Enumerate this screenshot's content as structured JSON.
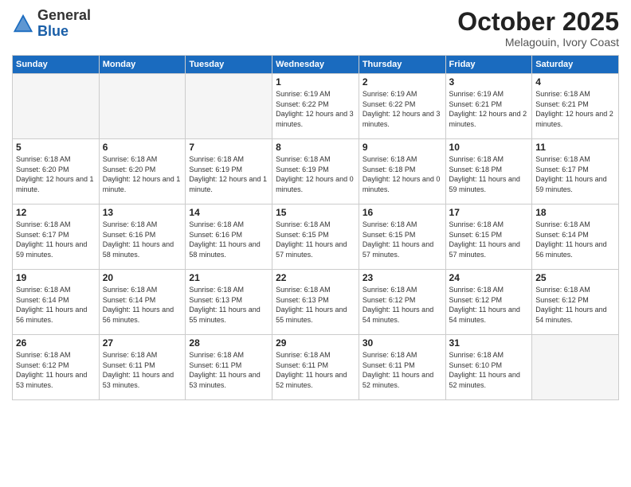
{
  "header": {
    "logo_line1": "General",
    "logo_line2": "Blue",
    "title": "October 2025",
    "subtitle": "Melagouin, Ivory Coast"
  },
  "days_of_week": [
    "Sunday",
    "Monday",
    "Tuesday",
    "Wednesday",
    "Thursday",
    "Friday",
    "Saturday"
  ],
  "weeks": [
    [
      {
        "day": "",
        "info": ""
      },
      {
        "day": "",
        "info": ""
      },
      {
        "day": "",
        "info": ""
      },
      {
        "day": "1",
        "info": "Sunrise: 6:19 AM\nSunset: 6:22 PM\nDaylight: 12 hours\nand 3 minutes."
      },
      {
        "day": "2",
        "info": "Sunrise: 6:19 AM\nSunset: 6:22 PM\nDaylight: 12 hours\nand 3 minutes."
      },
      {
        "day": "3",
        "info": "Sunrise: 6:19 AM\nSunset: 6:21 PM\nDaylight: 12 hours\nand 2 minutes."
      },
      {
        "day": "4",
        "info": "Sunrise: 6:18 AM\nSunset: 6:21 PM\nDaylight: 12 hours\nand 2 minutes."
      }
    ],
    [
      {
        "day": "5",
        "info": "Sunrise: 6:18 AM\nSunset: 6:20 PM\nDaylight: 12 hours\nand 1 minute."
      },
      {
        "day": "6",
        "info": "Sunrise: 6:18 AM\nSunset: 6:20 PM\nDaylight: 12 hours\nand 1 minute."
      },
      {
        "day": "7",
        "info": "Sunrise: 6:18 AM\nSunset: 6:19 PM\nDaylight: 12 hours\nand 1 minute."
      },
      {
        "day": "8",
        "info": "Sunrise: 6:18 AM\nSunset: 6:19 PM\nDaylight: 12 hours\nand 0 minutes."
      },
      {
        "day": "9",
        "info": "Sunrise: 6:18 AM\nSunset: 6:18 PM\nDaylight: 12 hours\nand 0 minutes."
      },
      {
        "day": "10",
        "info": "Sunrise: 6:18 AM\nSunset: 6:18 PM\nDaylight: 11 hours\nand 59 minutes."
      },
      {
        "day": "11",
        "info": "Sunrise: 6:18 AM\nSunset: 6:17 PM\nDaylight: 11 hours\nand 59 minutes."
      }
    ],
    [
      {
        "day": "12",
        "info": "Sunrise: 6:18 AM\nSunset: 6:17 PM\nDaylight: 11 hours\nand 59 minutes."
      },
      {
        "day": "13",
        "info": "Sunrise: 6:18 AM\nSunset: 6:16 PM\nDaylight: 11 hours\nand 58 minutes."
      },
      {
        "day": "14",
        "info": "Sunrise: 6:18 AM\nSunset: 6:16 PM\nDaylight: 11 hours\nand 58 minutes."
      },
      {
        "day": "15",
        "info": "Sunrise: 6:18 AM\nSunset: 6:15 PM\nDaylight: 11 hours\nand 57 minutes."
      },
      {
        "day": "16",
        "info": "Sunrise: 6:18 AM\nSunset: 6:15 PM\nDaylight: 11 hours\nand 57 minutes."
      },
      {
        "day": "17",
        "info": "Sunrise: 6:18 AM\nSunset: 6:15 PM\nDaylight: 11 hours\nand 57 minutes."
      },
      {
        "day": "18",
        "info": "Sunrise: 6:18 AM\nSunset: 6:14 PM\nDaylight: 11 hours\nand 56 minutes."
      }
    ],
    [
      {
        "day": "19",
        "info": "Sunrise: 6:18 AM\nSunset: 6:14 PM\nDaylight: 11 hours\nand 56 minutes."
      },
      {
        "day": "20",
        "info": "Sunrise: 6:18 AM\nSunset: 6:14 PM\nDaylight: 11 hours\nand 56 minutes."
      },
      {
        "day": "21",
        "info": "Sunrise: 6:18 AM\nSunset: 6:13 PM\nDaylight: 11 hours\nand 55 minutes."
      },
      {
        "day": "22",
        "info": "Sunrise: 6:18 AM\nSunset: 6:13 PM\nDaylight: 11 hours\nand 55 minutes."
      },
      {
        "day": "23",
        "info": "Sunrise: 6:18 AM\nSunset: 6:12 PM\nDaylight: 11 hours\nand 54 minutes."
      },
      {
        "day": "24",
        "info": "Sunrise: 6:18 AM\nSunset: 6:12 PM\nDaylight: 11 hours\nand 54 minutes."
      },
      {
        "day": "25",
        "info": "Sunrise: 6:18 AM\nSunset: 6:12 PM\nDaylight: 11 hours\nand 54 minutes."
      }
    ],
    [
      {
        "day": "26",
        "info": "Sunrise: 6:18 AM\nSunset: 6:12 PM\nDaylight: 11 hours\nand 53 minutes."
      },
      {
        "day": "27",
        "info": "Sunrise: 6:18 AM\nSunset: 6:11 PM\nDaylight: 11 hours\nand 53 minutes."
      },
      {
        "day": "28",
        "info": "Sunrise: 6:18 AM\nSunset: 6:11 PM\nDaylight: 11 hours\nand 53 minutes."
      },
      {
        "day": "29",
        "info": "Sunrise: 6:18 AM\nSunset: 6:11 PM\nDaylight: 11 hours\nand 52 minutes."
      },
      {
        "day": "30",
        "info": "Sunrise: 6:18 AM\nSunset: 6:11 PM\nDaylight: 11 hours\nand 52 minutes."
      },
      {
        "day": "31",
        "info": "Sunrise: 6:18 AM\nSunset: 6:10 PM\nDaylight: 11 hours\nand 52 minutes."
      },
      {
        "day": "",
        "info": ""
      }
    ]
  ]
}
